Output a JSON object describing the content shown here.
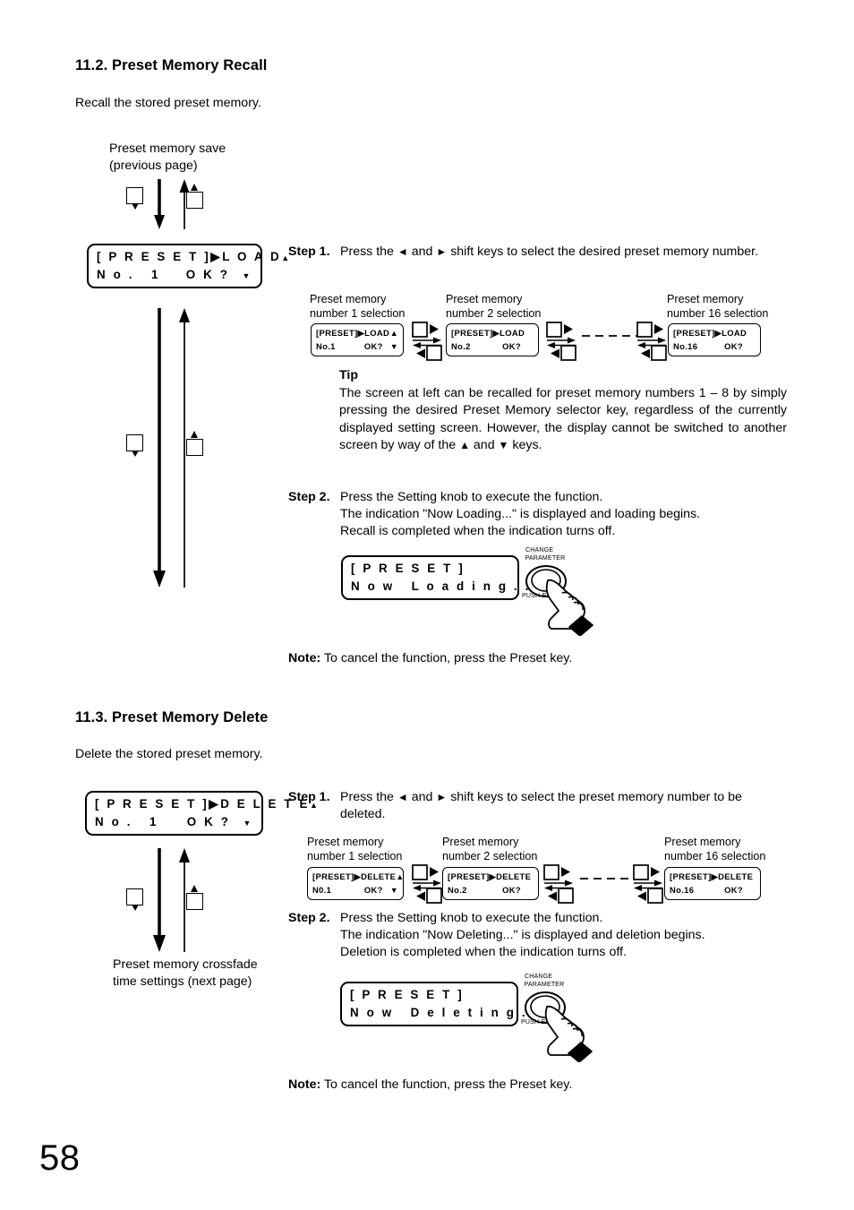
{
  "page": {
    "number": "58"
  },
  "section_recall": {
    "heading": "11.2. Preset Memory Recall",
    "intro": "Recall the stored preset memory.",
    "flow_top_label_line1": "Preset memory save",
    "flow_top_label_line2": "(previous page)",
    "main_lcd": {
      "line1_left": "[ P R E S E T ]",
      "line1_mid": "▶L O A D",
      "line1_right": "▲",
      "line2_left": "N o .   1",
      "line2_mid": "O K ?",
      "line2_right": "▼"
    },
    "step1": {
      "label": "Step 1.",
      "text_before": "Press the",
      "arrow_left": "◄",
      "text_and": "and",
      "arrow_right": "►",
      "text_after": "shift keys to select the desired preset memory number."
    },
    "selection_row": [
      {
        "caption_line1": "Preset memory",
        "caption_line2": "number 1 selection",
        "lcd_line1_left": "[PRESET]▶LOAD",
        "lcd_line1_right": "▲",
        "lcd_line2_left": "No.1",
        "lcd_line2_mid": "OK?",
        "lcd_line2_right": "▼"
      },
      {
        "caption_line1": "Preset memory",
        "caption_line2": "number 2 selection",
        "lcd_line1_left": "[PRESET]▶LOAD",
        "lcd_line1_right": "",
        "lcd_line2_left": "No.2",
        "lcd_line2_mid": "OK?",
        "lcd_line2_right": ""
      },
      {
        "caption_line1": "Preset memory",
        "caption_line2": "number 16 selection",
        "lcd_line1_left": "[PRESET]▶LOAD",
        "lcd_line1_right": "",
        "lcd_line2_left": "No.16",
        "lcd_line2_mid": "OK?",
        "lcd_line2_right": ""
      }
    ],
    "tip": {
      "label": "Tip",
      "text_part1": "The screen at left can be recalled for preset memory numbers 1 – 8 by simply pressing the desired Preset Memory selector key, regardless of the currently displayed setting screen. However, the display cannot be switched to another screen by way of the",
      "arrow_up": "▲",
      "text_and": "and",
      "arrow_down": "▼",
      "text_part2": "keys."
    },
    "step2": {
      "label": "Step 2.",
      "line1": "Press the Setting knob to execute the function.",
      "line2": "The indication \"Now Loading...\" is displayed and loading begins.",
      "line3": "Recall is completed when the indication turns off."
    },
    "status_lcd": {
      "line1": "[ P R E S E T ]",
      "line2": "N o w   L o a d i n g . . ."
    },
    "knob": {
      "label_line1": "CHANGE",
      "label_line2": "PARAMETER",
      "label_push": "PUSH-E"
    },
    "note": {
      "label": "Note:",
      "text": "To cancel the function, press the Preset key."
    }
  },
  "section_delete": {
    "heading": "11.3. Preset Memory Delete",
    "intro": "Delete the stored preset memory.",
    "main_lcd": {
      "line1_left": "[ P R E S E T ]",
      "line1_mid": "▶D E L E T E",
      "line1_right": "▲",
      "line2_left": "N o .   1",
      "line2_mid": "O K ?",
      "line2_right": "▼"
    },
    "flow_bottom_label_line1": "Preset memory crossfade",
    "flow_bottom_label_line2": "time settings (next page)",
    "step1": {
      "label": "Step 1.",
      "text_before": "Press the",
      "arrow_left": "◄",
      "text_and": "and",
      "arrow_right": "►",
      "text_after": "shift keys to select the preset memory number to be deleted."
    },
    "selection_row": [
      {
        "caption_line1": "Preset memory",
        "caption_line2": "number 1 selection",
        "lcd_line1_left": "[PRESET]▶DELETE",
        "lcd_line1_right": "▲",
        "lcd_line2_left": "N0.1",
        "lcd_line2_mid": "OK?",
        "lcd_line2_right": "▼"
      },
      {
        "caption_line1": "Preset memory",
        "caption_line2": "number 2 selection",
        "lcd_line1_left": "[PRESET]▶DELETE",
        "lcd_line1_right": "",
        "lcd_line2_left": "No.2",
        "lcd_line2_mid": "OK?",
        "lcd_line2_right": ""
      },
      {
        "caption_line1": "Preset memory",
        "caption_line2": "number 16 selection",
        "lcd_line1_left": "[PRESET]▶DELETE",
        "lcd_line1_right": "",
        "lcd_line2_left": "No.16",
        "lcd_line2_mid": "OK?",
        "lcd_line2_right": ""
      }
    ],
    "step2": {
      "label": "Step 2.",
      "line1": "Press the Setting knob to execute the function.",
      "line2": "The indication \"Now Deleting...\" is displayed and deletion begins.",
      "line3": "Deletion is completed when the indication turns off."
    },
    "status_lcd": {
      "line1": "[ P R E S E T ]",
      "line2": "N o w   D e l e t i n g . . ."
    },
    "knob": {
      "label_line1": "CHANGE",
      "label_line2": "PARAMETER",
      "label_push": "PUSH-E"
    },
    "note": {
      "label": "Note:",
      "text": "To cancel the function, press the Preset key."
    }
  }
}
